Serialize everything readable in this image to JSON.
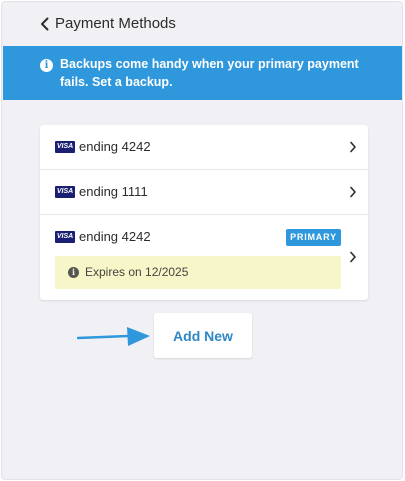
{
  "header": {
    "title": "Payment Methods",
    "back_icon": "chevron-left-icon"
  },
  "banner": {
    "text": "Backups come handy when your primary payment fails. Set a backup.",
    "icon": "info-icon",
    "color": "#2f97db"
  },
  "cards": [
    {
      "brand": "VISA",
      "label": "ending 4242",
      "primary": false
    },
    {
      "brand": "VISA",
      "label": "ending 1111",
      "primary": false
    },
    {
      "brand": "VISA",
      "label": "ending 4242",
      "primary": true,
      "badge": "PRIMARY",
      "expiry": "Expires on 12/2025"
    }
  ],
  "add_button": {
    "label": "Add New"
  },
  "colors": {
    "accent": "#2f97db",
    "visa": "#1a1f71",
    "expiry_bg": "#f6f6c8",
    "background": "#f1f1f5"
  }
}
